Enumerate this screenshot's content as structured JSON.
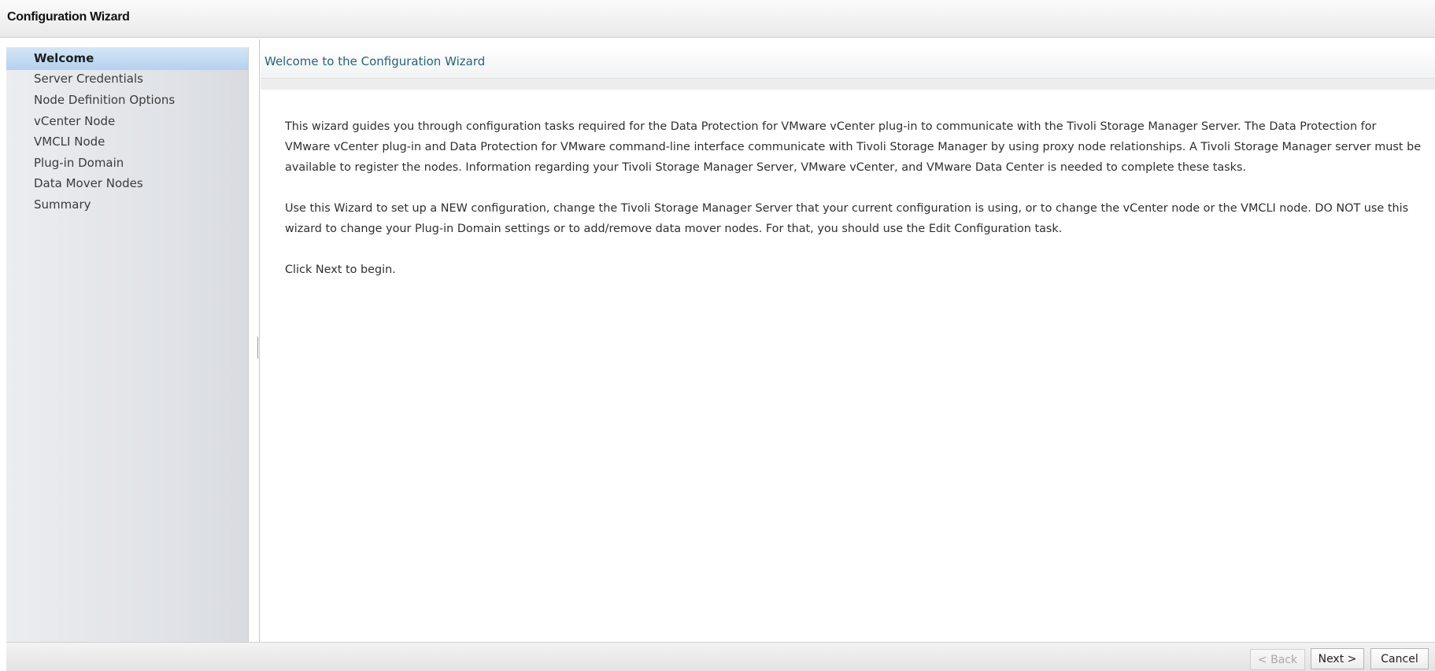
{
  "window": {
    "title": "Configuration Wizard"
  },
  "nav": {
    "items": [
      {
        "label": "Welcome",
        "active": true
      },
      {
        "label": "Server Credentials",
        "active": false
      },
      {
        "label": "Node Definition Options",
        "active": false
      },
      {
        "label": "vCenter Node",
        "active": false
      },
      {
        "label": "VMCLI Node",
        "active": false
      },
      {
        "label": "Plug-in Domain",
        "active": false
      },
      {
        "label": "Data Mover Nodes",
        "active": false
      },
      {
        "label": "Summary",
        "active": false
      }
    ]
  },
  "content": {
    "title": "Welcome to the Configuration Wizard",
    "paragraphs": [
      "This wizard guides you through configuration tasks required for the Data Protection for VMware vCenter plug-in to communicate with the Tivoli Storage Manager Server. The Data Protection for VMware vCenter plug-in and Data Protection for VMware command-line interface communicate with Tivoli Storage Manager by using proxy node relationships. A Tivoli Storage Manager server must be available to register the nodes. Information regarding your Tivoli Storage Manager Server, VMware vCenter, and VMware Data Center is needed to complete these tasks.",
      "Use this Wizard to set up a NEW configuration, change the Tivoli Storage Manager Server that your current configuration is using, or to change the vCenter node or the VMCLI node. DO NOT use this wizard to change your Plug-in Domain settings or to add/remove data mover nodes. For that, you should use the Edit Configuration task.",
      "Click Next to begin."
    ]
  },
  "footer": {
    "back_label": "< Back",
    "next_label": "Next >",
    "cancel_label": "Cancel"
  }
}
